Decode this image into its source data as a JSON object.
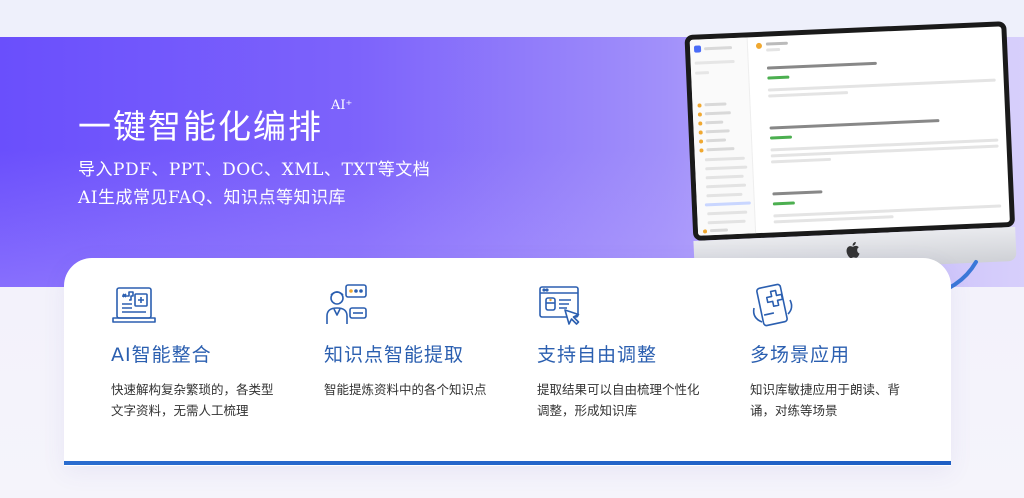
{
  "hero": {
    "title": "一键智能化编排",
    "title_sup": "AI⁺",
    "line1": "导入PDF、PPT、DOC、XML、TXT等文档",
    "line2": "AI生成常见FAQ、知识点等知识库"
  },
  "features": [
    {
      "icon": "medical-document-icon",
      "title": "AI智能整合",
      "desc": "快速解构复杂繁琐的，各类型文字资料，无需人工梳理"
    },
    {
      "icon": "doctor-chat-icon",
      "title": "知识点智能提取",
      "desc": "智能提炼资料中的各个知识点"
    },
    {
      "icon": "browser-pill-cursor-icon",
      "title": "支持自由调整",
      "desc": "提取结果可以自由梳理个性化调整，形成知识库"
    },
    {
      "icon": "phone-medical-icon",
      "title": "多场景应用",
      "desc": "知识库敏捷应用于朗读、背诵，对练等场景"
    }
  ],
  "colors": {
    "accent": "#2b5fb0",
    "hero_start": "#6a4ffc",
    "hero_end": "#d7cffb"
  }
}
